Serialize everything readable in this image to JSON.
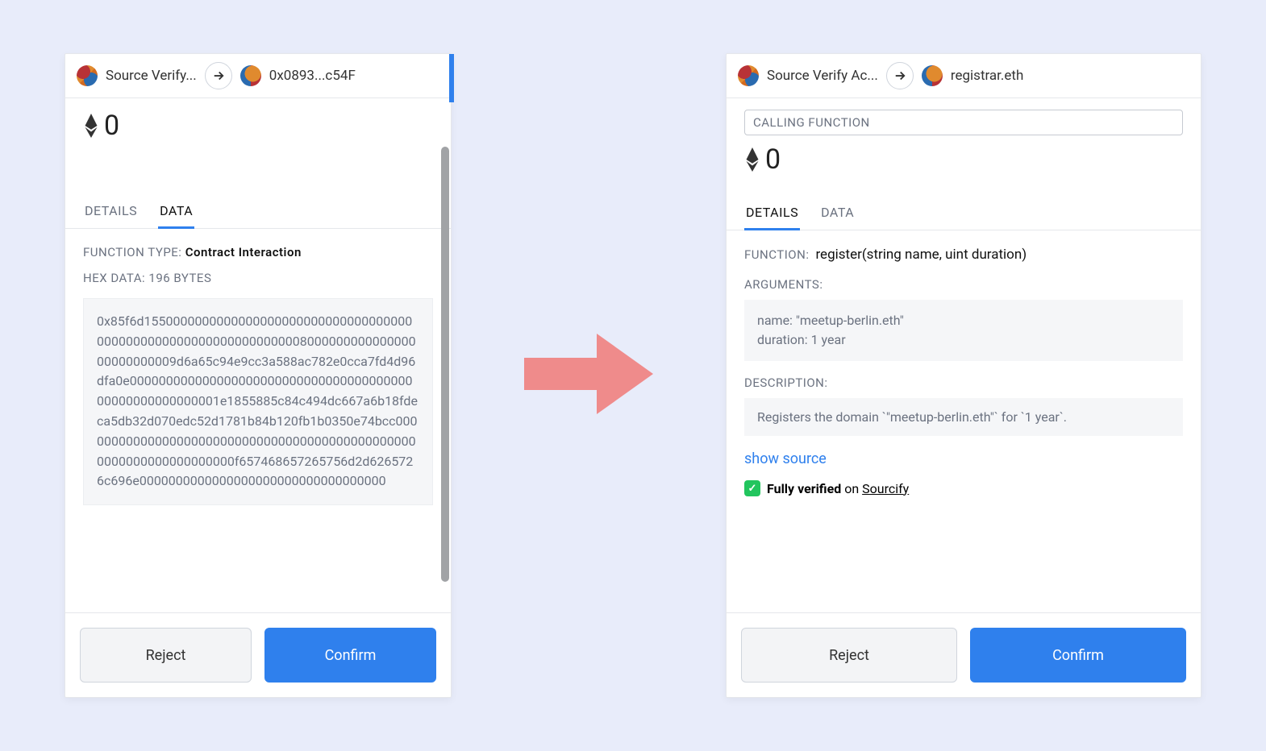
{
  "leftPanel": {
    "header": {
      "sourceLabel": "Source Verify...",
      "targetLabel": "0x0893...c54F"
    },
    "ethValue": "0",
    "tabs": {
      "details": "DETAILS",
      "data": "DATA",
      "active": "data"
    },
    "functionTypeLabel": "FUNCTION TYPE:",
    "functionTypeValue": "Contract Interaction",
    "hexLabel": "HEX DATA: 196 BYTES",
    "hexData": "0x85f6d15500000000000000000000000000000000000000000000000000000000000000800000000000000000000000009d6a65c94e9cc3a588ac782e0cca7fd4d96dfa0e00000000000000000000000000000000000000000000000000000001e1855885c84c494dc667a6b18fdeca5db32d070edc52d1781b84b120fb1b0350e74bcc000000000000000000000000000000000000000000000000000000000000000000f657468657265756d2d6265726c696e0000000000000000000000000000000000",
    "buttons": {
      "reject": "Reject",
      "confirm": "Confirm"
    }
  },
  "rightPanel": {
    "header": {
      "sourceLabel": "Source Verify Ac...",
      "targetLabel": "registrar.eth"
    },
    "chip": "CALLING FUNCTION",
    "ethValue": "0",
    "tabs": {
      "details": "DETAILS",
      "data": "DATA",
      "active": "details"
    },
    "functionLabel": "FUNCTION:",
    "functionSignature": "register(string name, uint duration)",
    "argumentsLabel": "ARGUMENTS:",
    "arguments": "name: \"meetup-berlin.eth\"\nduration: 1 year",
    "descriptionLabel": "DESCRIPTION:",
    "descriptionValue": "Registers the domain `\"meetup-berlin.eth\"` for `1 year`.",
    "showSource": "show source",
    "verified": {
      "strong": "Fully verified",
      "mid": " on ",
      "link": "Sourcify"
    },
    "buttons": {
      "reject": "Reject",
      "confirm": "Confirm"
    }
  }
}
